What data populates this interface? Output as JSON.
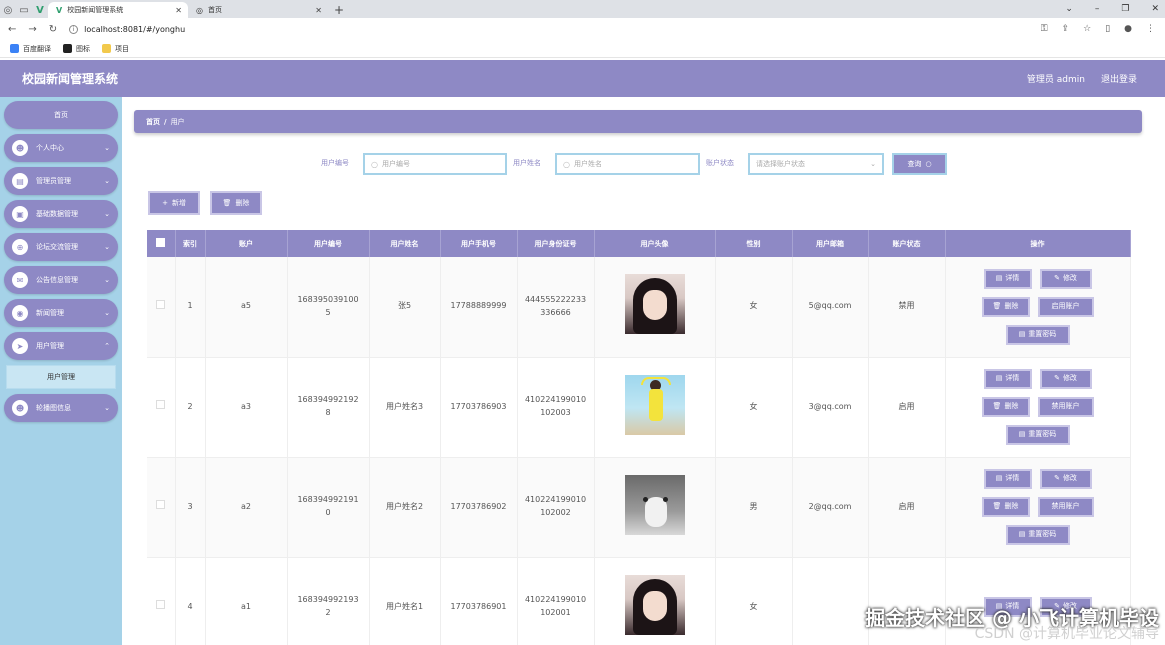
{
  "browser": {
    "tabs": [
      {
        "label": "校园新闻管理系统",
        "active": true
      },
      {
        "label": "首页",
        "active": false
      }
    ],
    "url": "localhost:8081/#/yonghu",
    "bookmarks": [
      {
        "label": "百度翻译",
        "color": "#3b82f6"
      },
      {
        "label": "图标",
        "color": "#222222"
      },
      {
        "label": "项目",
        "color": "#f2c94c"
      }
    ]
  },
  "header": {
    "title": "校园新闻管理系统",
    "user": "管理员 admin",
    "logout": "退出登录"
  },
  "sidebar": {
    "home": "首页",
    "items": [
      {
        "label": "个人中心",
        "icon": "person-icon"
      },
      {
        "label": "管理员管理",
        "icon": "admin-icon"
      },
      {
        "label": "基础数据管理",
        "icon": "data-icon"
      },
      {
        "label": "论坛交流管理",
        "icon": "forum-icon"
      },
      {
        "label": "公告信息管理",
        "icon": "notice-icon"
      },
      {
        "label": "新闻管理",
        "icon": "news-icon"
      },
      {
        "label": "用户管理",
        "icon": "user-icon"
      },
      {
        "label": "轮播图信息",
        "icon": "carousel-icon"
      }
    ],
    "submenu": "用户管理"
  },
  "breadcrumb": {
    "home": "首页",
    "sep": "/",
    "current": "用户"
  },
  "search": {
    "label_code": "用户编号",
    "placeholder_code": "用户编号",
    "label_name": "用户姓名",
    "placeholder_name": "用户姓名",
    "label_status": "账户状态",
    "placeholder_status": "请选择账户状态",
    "query": "查询"
  },
  "actions": {
    "add": "新增",
    "delete": "删除"
  },
  "table": {
    "headers": [
      "索引",
      "账户",
      "用户编号",
      "用户姓名",
      "用户手机号",
      "用户身份证号",
      "用户头像",
      "性别",
      "用户邮箱",
      "账户状态",
      "操作"
    ],
    "rows": [
      {
        "index": "1",
        "account": "a5",
        "code": "1683950391005",
        "name": "张5",
        "phone": "17788889999",
        "idcard": "444555222233336666",
        "gender": "女",
        "email": "5@qq.com",
        "status": "禁用",
        "toggle": "启用账户",
        "avatar": "girl"
      },
      {
        "index": "2",
        "account": "a3",
        "code": "1683949921928",
        "name": "用户姓名3",
        "phone": "17703786903",
        "idcard": "410224199010102003",
        "gender": "女",
        "email": "3@qq.com",
        "status": "启用",
        "toggle": "禁用账户",
        "avatar": "yellow"
      },
      {
        "index": "3",
        "account": "a2",
        "code": "1683949921910",
        "name": "用户姓名2",
        "phone": "17703786902",
        "idcard": "410224199010102002",
        "gender": "男",
        "email": "2@qq.com",
        "status": "启用",
        "toggle": "禁用账户",
        "avatar": "dog"
      },
      {
        "index": "4",
        "account": "a1",
        "code": "1683949921932",
        "name": "用户姓名1",
        "phone": "17703786901",
        "idcard": "410224199010102001",
        "gender": "女",
        "email": "",
        "status": "",
        "toggle": "",
        "avatar": "girl"
      }
    ],
    "ops": {
      "detail": "详情",
      "edit": "修改",
      "delete": "删除",
      "reset": "重置密码"
    }
  },
  "watermark": {
    "line1": "掘金技术社区 @ 小飞计算机毕设",
    "line2": "CSDN @计算机毕业论文辅导"
  },
  "colors": {
    "primary": "#8e89c5",
    "sidebar": "#a5d2e8",
    "input_border": "#a5d2e8"
  }
}
